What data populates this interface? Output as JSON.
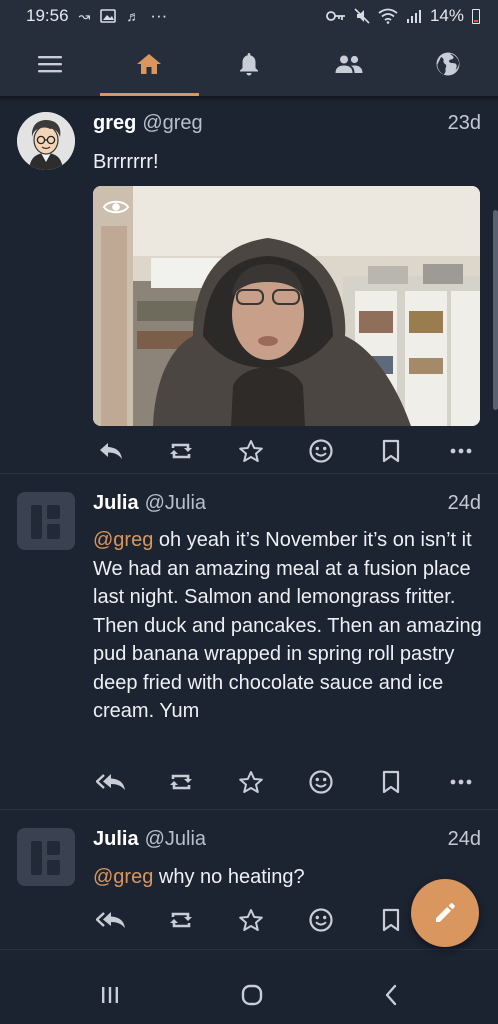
{
  "status_bar": {
    "time": "19:56",
    "more": "···",
    "battery": "14%"
  },
  "nav": {
    "tabs": [
      {
        "icon": "home-icon",
        "active": true
      },
      {
        "icon": "bell-icon",
        "active": false
      },
      {
        "icon": "people-icon",
        "active": false
      },
      {
        "icon": "globe-icon",
        "active": false
      }
    ]
  },
  "posts": [
    {
      "name": "greg",
      "handle": "@greg",
      "time": "23d",
      "text": "Brrrrrrr!",
      "has_media": true
    },
    {
      "name": "Julia",
      "handle": "@Julia",
      "time": "24d",
      "mention": "@greg",
      "text_first": " oh yeah it’s November it’s on isn’t it",
      "text_rest": "We had an amazing meal at a fusion place last night. Salmon and lemongrass fritter. Then duck and pancakes. Then an amazing pud banana wrapped in spring roll pastry deep fried with chocolate sauce and ice cream. Yum"
    },
    {
      "name": "Julia",
      "handle": "@Julia",
      "time": "24d",
      "mention": "@greg",
      "text_first": " why no heating?"
    }
  ],
  "colors": {
    "accent": "#d9975f",
    "background": "#1c2331",
    "bar": "#262d3b"
  }
}
